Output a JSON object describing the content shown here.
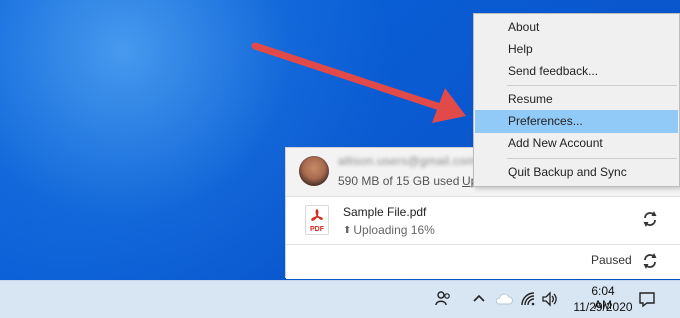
{
  "context_menu": {
    "items": [
      {
        "label": "About"
      },
      {
        "label": "Help"
      },
      {
        "label": "Send feedback..."
      },
      {
        "label": "Resume"
      },
      {
        "label": "Preferences..."
      },
      {
        "label": "Add New Account"
      },
      {
        "label": "Quit Backup and Sync"
      }
    ],
    "highlighted_item": "Preferences...",
    "highlight_color": "#91c9f7"
  },
  "backup_panel": {
    "storage_text": "590 MB of 15 GB used",
    "upgrade_text": "Up",
    "file": {
      "name": "Sample File.pdf",
      "icon_label": "PDF",
      "status_text": "Uploading 16%",
      "progress": 0.16
    },
    "footer_status": "Paused"
  },
  "taskbar": {
    "time": "6:04 AM",
    "date": "11/29/2020"
  },
  "annotation": {
    "arrow_color": "#e24a4a"
  },
  "colors": {
    "desktop": "#0a63d8",
    "menu_bg": "#f0f0f0",
    "taskbar": "#d8e6f3"
  }
}
